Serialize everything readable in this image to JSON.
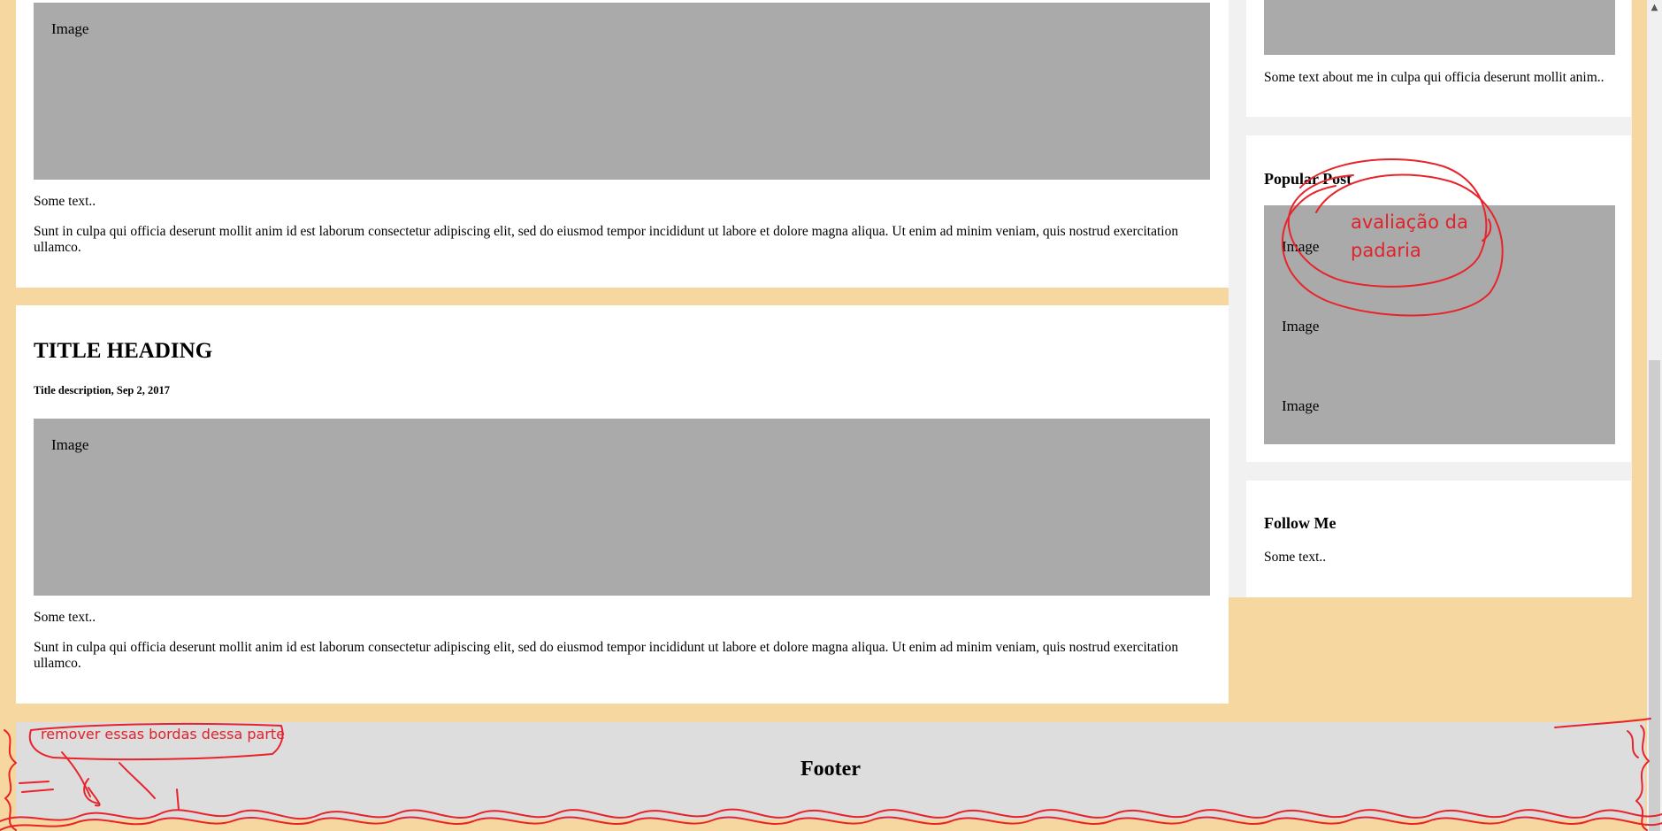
{
  "posts": [
    {
      "image_label": "Image",
      "caption": "Some text..",
      "body": "Sunt in culpa qui officia deserunt mollit anim id est laborum consectetur adipiscing elit, sed do eiusmod tempor incididunt ut labore et dolore magna aliqua. Ut enim ad minim veniam, quis nostrud exercitation ullamco."
    },
    {
      "title": "TITLE HEADING",
      "subtitle": "Title description, Sep 2, 2017",
      "image_label": "Image",
      "caption": "Some text..",
      "body": "Sunt in culpa qui officia deserunt mollit anim id est laborum consectetur adipiscing elit, sed do eiusmod tempor incididunt ut labore et dolore magna aliqua. Ut enim ad minim veniam, quis nostrud exercitation ullamco."
    }
  ],
  "sidebar": {
    "about_text": "Some text about me in culpa qui officia deserunt mollit anim..",
    "popular": {
      "heading": "Popular Post",
      "images": [
        "Image",
        "Image",
        "Image"
      ]
    },
    "follow": {
      "heading": "Follow Me",
      "text": "Some text.."
    }
  },
  "footer": {
    "text": "Footer"
  },
  "annotations": {
    "bakery_note_line1": "avaliação da",
    "bakery_note_line2": "padaria",
    "footer_note": "remover essas bordas dessa parte"
  },
  "colors": {
    "page_bg": "#f5d79f",
    "card_bg": "#ffffff",
    "image_placeholder": "#aaaaaa",
    "footer_bg": "#dddddd",
    "annotation_red": "#e0222b"
  }
}
